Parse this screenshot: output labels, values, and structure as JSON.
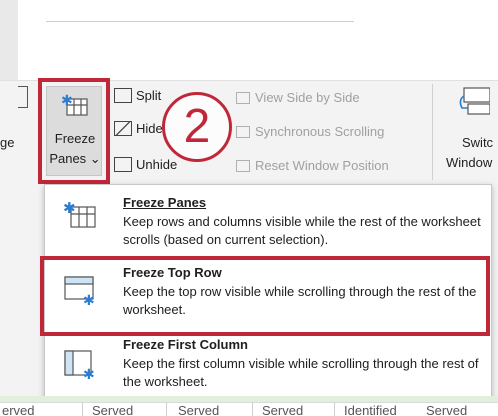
{
  "ribbon": {
    "left_fragment": "ge",
    "freeze_panes": {
      "line1": "Freeze",
      "line2": "Panes ⌄"
    },
    "window_group": {
      "split": "Split",
      "hide": "Hide",
      "unhide": "Unhide"
    },
    "annotation_number": "2",
    "view_side_by_side": "View Side by Side",
    "synchronous_scrolling": "Synchronous Scrolling",
    "reset_window_position": "Reset Window Position",
    "switch_windows": {
      "line1": "Switc",
      "line2": "Window"
    }
  },
  "menu": {
    "items": [
      {
        "title": "Freeze Panes",
        "description": "Keep rows and columns visible while the rest of the worksheet scrolls (based on current selection).",
        "icon": "freeze-panes-icon"
      },
      {
        "title": "Freeze Top Row",
        "description": "Keep the top row visible while scrolling through the rest of the worksheet.",
        "icon": "freeze-top-row-icon"
      },
      {
        "title": "Freeze First Column",
        "description": "Keep the first column visible while scrolling through the rest of the worksheet.",
        "icon": "freeze-first-column-icon"
      }
    ]
  },
  "bottom_row": [
    "erved",
    "Served",
    "Served",
    "Served",
    "Identified",
    "Served"
  ],
  "colors": {
    "highlight": "#c0283a",
    "accent": "#2b7cd3"
  }
}
